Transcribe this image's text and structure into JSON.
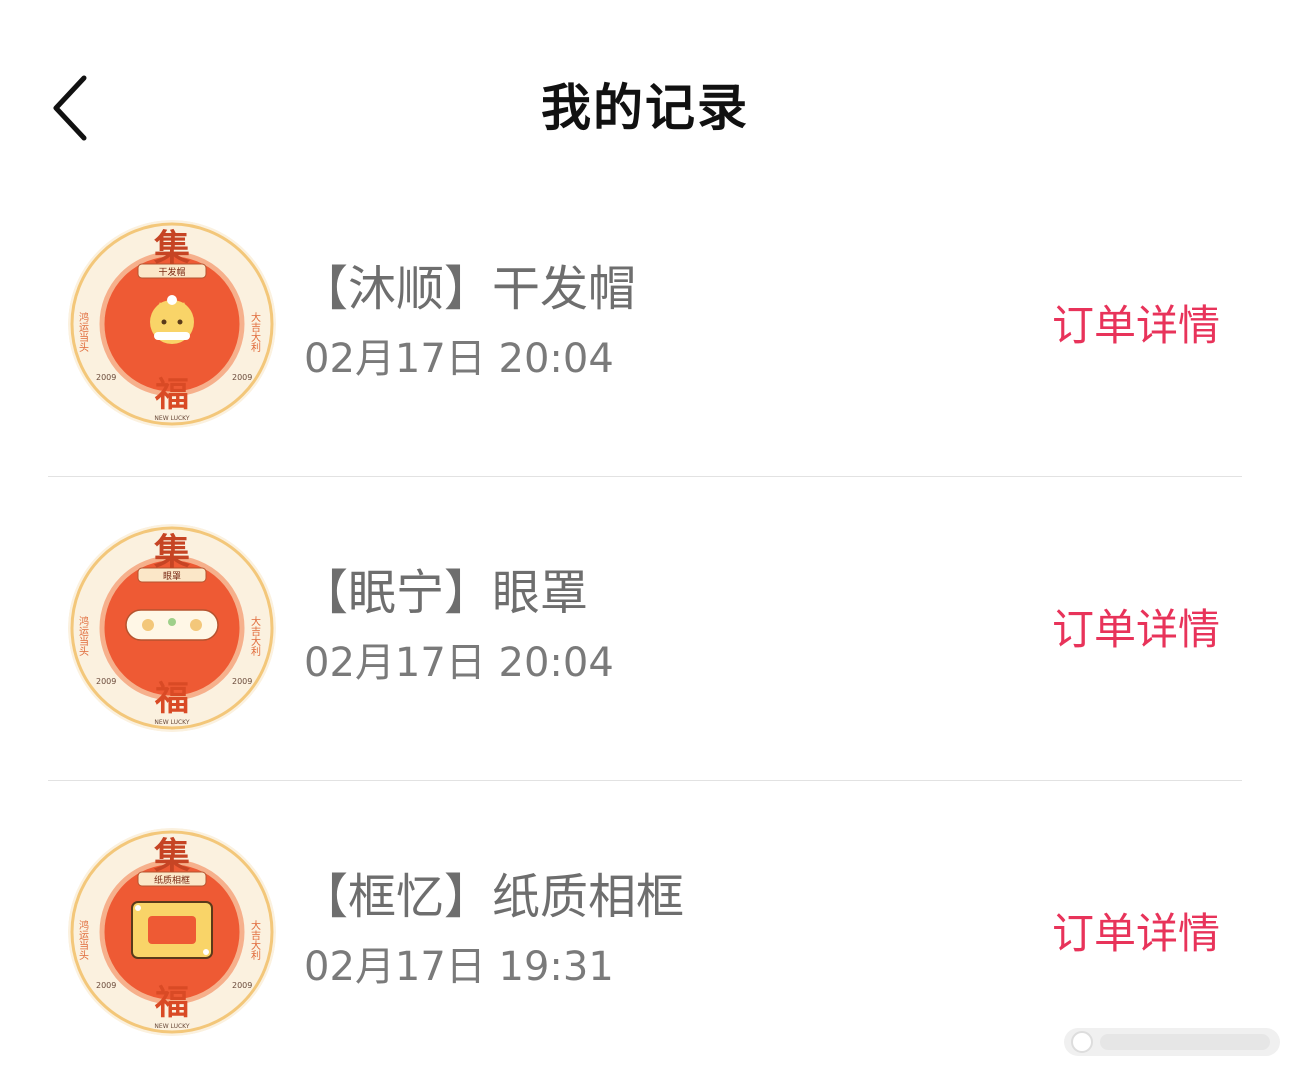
{
  "header": {
    "title": "我的记录"
  },
  "records": [
    {
      "badge_text": "干发帽",
      "title": "【沐顺】干发帽",
      "time": "02月17日  20:04",
      "action": "订单详情"
    },
    {
      "badge_text": "眼罩",
      "title": "【眠宁】眼罩",
      "time": "02月17日  20:04",
      "action": "订单详情"
    },
    {
      "badge_text": "纸质相框",
      "title": "【框忆】纸质相框",
      "time": "02月17日  19:31",
      "action": "订单详情"
    }
  ],
  "thumbnail_art": {
    "top_char": "集",
    "bottom_char": "福",
    "left_column": "鸿运当头",
    "right_column": "大吉大利",
    "year": "2009",
    "caption": "NEW LUCKY"
  },
  "colors": {
    "accent": "#e8335a",
    "card_red": "#ee5a34",
    "card_cream": "#fbf1df"
  }
}
